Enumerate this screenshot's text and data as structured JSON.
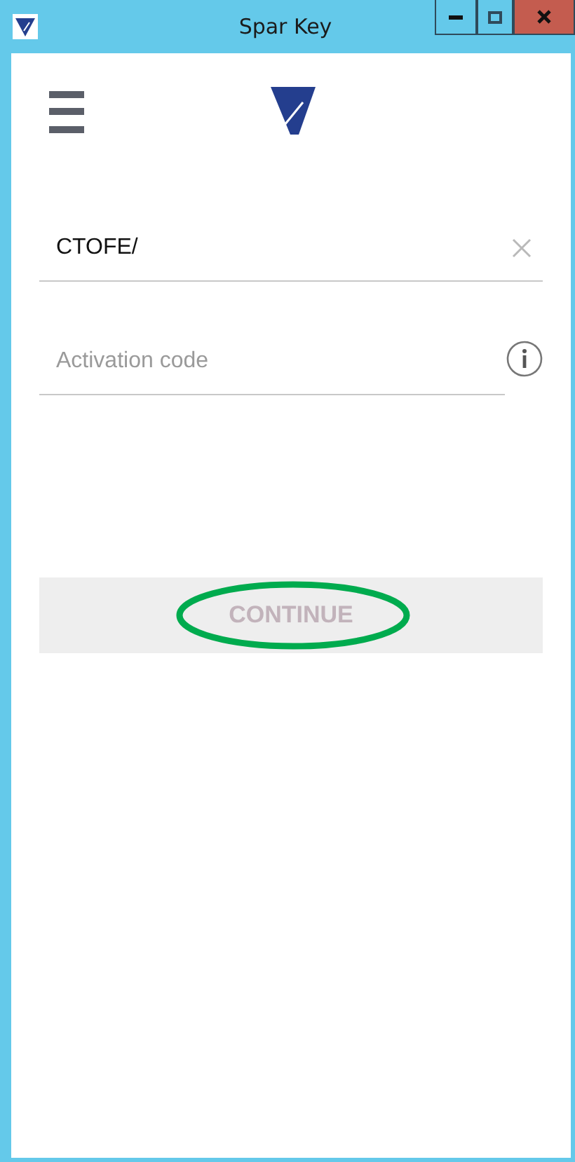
{
  "window": {
    "title": "Spar Key"
  },
  "login_field": {
    "value": "CTOFE/"
  },
  "activation_field": {
    "placeholder": "Activation code"
  },
  "continue_button": {
    "label": "CONTINUE",
    "disabled": true,
    "highlighted": true
  }
}
